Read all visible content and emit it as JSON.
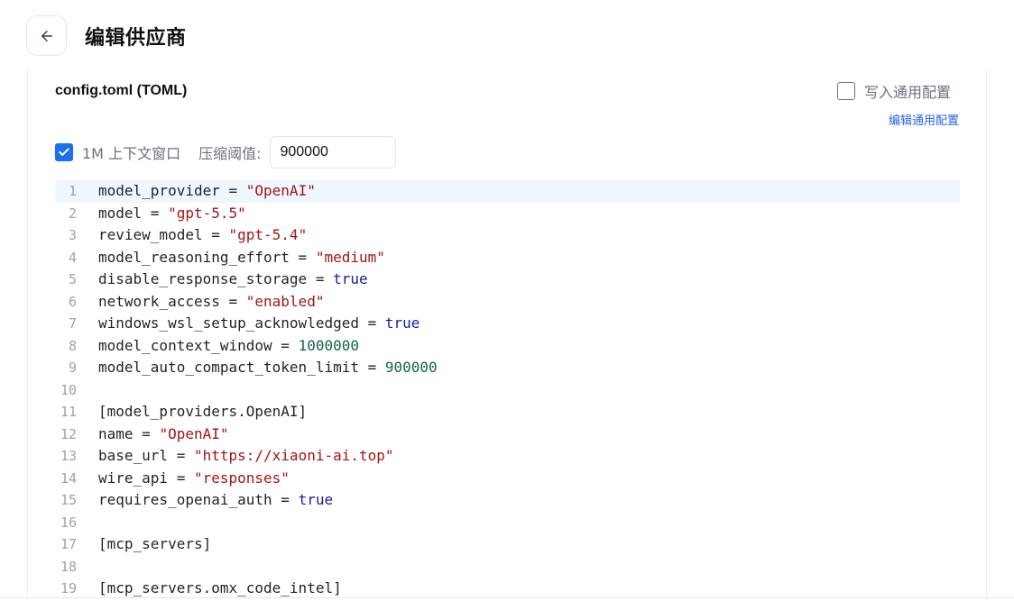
{
  "header": {
    "title": "编辑供应商"
  },
  "config": {
    "title": "config.toml (TOML)",
    "write_common_label": "写入通用配置",
    "write_common_checked": false,
    "edit_common_link": "编辑通用配置",
    "context_window_label": "1M 上下文窗口",
    "context_window_checked": true,
    "threshold_label": "压缩阈值:",
    "threshold_value": "900000"
  },
  "editor": {
    "active_line": 1,
    "lines": [
      {
        "n": "1",
        "tokens": [
          {
            "t": "model_provider = ",
            "k": "plain"
          },
          {
            "t": "\"OpenAI\"",
            "k": "str"
          }
        ]
      },
      {
        "n": "2",
        "tokens": [
          {
            "t": "model = ",
            "k": "plain"
          },
          {
            "t": "\"gpt-5.5\"",
            "k": "str"
          }
        ]
      },
      {
        "n": "3",
        "tokens": [
          {
            "t": "review_model = ",
            "k": "plain"
          },
          {
            "t": "\"gpt-5.4\"",
            "k": "str"
          }
        ]
      },
      {
        "n": "4",
        "tokens": [
          {
            "t": "model_reasoning_effort = ",
            "k": "plain"
          },
          {
            "t": "\"medium\"",
            "k": "str"
          }
        ]
      },
      {
        "n": "5",
        "tokens": [
          {
            "t": "disable_response_storage = ",
            "k": "plain"
          },
          {
            "t": "true",
            "k": "bool"
          }
        ]
      },
      {
        "n": "6",
        "tokens": [
          {
            "t": "network_access = ",
            "k": "plain"
          },
          {
            "t": "\"enabled\"",
            "k": "str"
          }
        ]
      },
      {
        "n": "7",
        "tokens": [
          {
            "t": "windows_wsl_setup_acknowledged = ",
            "k": "plain"
          },
          {
            "t": "true",
            "k": "bool"
          }
        ]
      },
      {
        "n": "8",
        "tokens": [
          {
            "t": "model_context_window = ",
            "k": "plain"
          },
          {
            "t": "1000000",
            "k": "num"
          }
        ]
      },
      {
        "n": "9",
        "tokens": [
          {
            "t": "model_auto_compact_token_limit = ",
            "k": "plain"
          },
          {
            "t": "900000",
            "k": "num"
          }
        ]
      },
      {
        "n": "10",
        "tokens": []
      },
      {
        "n": "11",
        "tokens": [
          {
            "t": "[model_providers.OpenAI]",
            "k": "plain"
          }
        ]
      },
      {
        "n": "12",
        "tokens": [
          {
            "t": "name = ",
            "k": "plain"
          },
          {
            "t": "\"OpenAI\"",
            "k": "str"
          }
        ]
      },
      {
        "n": "13",
        "tokens": [
          {
            "t": "base_url = ",
            "k": "plain"
          },
          {
            "t": "\"https://xiaoni-ai.top\"",
            "k": "str"
          }
        ]
      },
      {
        "n": "14",
        "tokens": [
          {
            "t": "wire_api = ",
            "k": "plain"
          },
          {
            "t": "\"responses\"",
            "k": "str"
          }
        ]
      },
      {
        "n": "15",
        "tokens": [
          {
            "t": "requires_openai_auth = ",
            "k": "plain"
          },
          {
            "t": "true",
            "k": "bool"
          }
        ]
      },
      {
        "n": "16",
        "tokens": []
      },
      {
        "n": "17",
        "tokens": [
          {
            "t": "[mcp_servers]",
            "k": "plain"
          }
        ]
      },
      {
        "n": "18",
        "tokens": []
      },
      {
        "n": "19",
        "tokens": [
          {
            "t": "[mcp_servers.omx_code_intel]",
            "k": "plain"
          }
        ]
      }
    ]
  },
  "colors": {
    "string": "#a31515",
    "boolean": "#1c1c9c",
    "number": "#116644",
    "accent": "#1d6ff2",
    "link": "#2563eb",
    "active_line_bg": "#eef6ff"
  }
}
